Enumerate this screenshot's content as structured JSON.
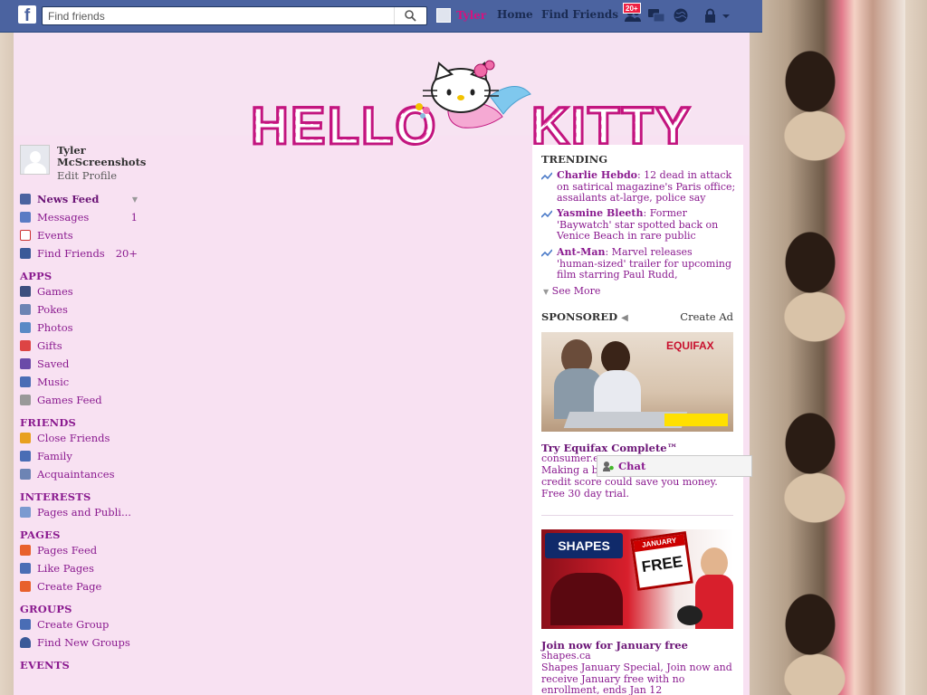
{
  "colors": {
    "fb_blue": "#4b63a0",
    "pink_bg": "#f8e1f2",
    "link_purple": "#8a1a8f",
    "notif_red": "#e22244"
  },
  "topbar": {
    "logo": "f",
    "search_placeholder": "Find friends",
    "user_name": "Tyler",
    "home_label": "Home",
    "find_friends_label": "Find Friends",
    "notif_badge": "20+"
  },
  "banner": {
    "word1": "HELLO",
    "word2": "KITTY"
  },
  "profile": {
    "name": "Tyler McScreenshots",
    "edit": "Edit Profile"
  },
  "nav": {
    "items": [
      {
        "label": "News Feed",
        "icon": "news-feed-icon"
      },
      {
        "label": "Messages",
        "count": "1",
        "icon": "messages-icon"
      },
      {
        "label": "Events",
        "icon": "events-icon"
      },
      {
        "label": "Find Friends",
        "count": "20+",
        "icon": "find-friends-icon"
      }
    ],
    "apps_title": "APPS",
    "apps": [
      "Games",
      "Pokes",
      "Photos",
      "Gifts",
      "Saved",
      "Music",
      "Games Feed"
    ],
    "friends_title": "FRIENDS",
    "friends": [
      "Close Friends",
      "Family",
      "Acquaintances"
    ],
    "interests_title": "INTERESTS",
    "interests": [
      "Pages and Publi..."
    ],
    "pages_title": "PAGES",
    "pages": [
      "Pages Feed",
      "Like Pages",
      "Create Page"
    ],
    "groups_title": "GROUPS",
    "groups": [
      "Create Group",
      "Find New Groups"
    ],
    "events_title": "EVENTS"
  },
  "trending": {
    "title": "TRENDING",
    "items": [
      {
        "topic": "Charlie Hebdo",
        "text": ": 12 dead in attack on satirical magazine's Paris office; assailants at-large, police say"
      },
      {
        "topic": "Yasmine Bleeth",
        "text": ": Former 'Baywatch' star spotted back on Venice Beach in rare public"
      },
      {
        "topic": "Ant-Man",
        "text": ": Marvel releases 'human-sized' trailer for upcoming film starring Paul Rudd,"
      }
    ],
    "see_more": "See More"
  },
  "sponsored": {
    "title": "SPONSORED",
    "create_ad": "Create Ad",
    "ads": [
      {
        "brand": "EQUIFAX",
        "title": "Try Equifax Complete™",
        "domain": "consumer.e",
        "text": "Making a bi",
        "text2": "credit score could save you money. Free 30 day trial."
      },
      {
        "brand": "SHAPES",
        "badge_top": "JANUARY",
        "badge_main": "FREE",
        "title": "Join now for January free",
        "domain": "shapes.ca",
        "text": "Shapes January Special, Join now and receive January free with no enrollment, ends Jan 12"
      }
    ]
  },
  "chat": {
    "label": "Chat"
  }
}
